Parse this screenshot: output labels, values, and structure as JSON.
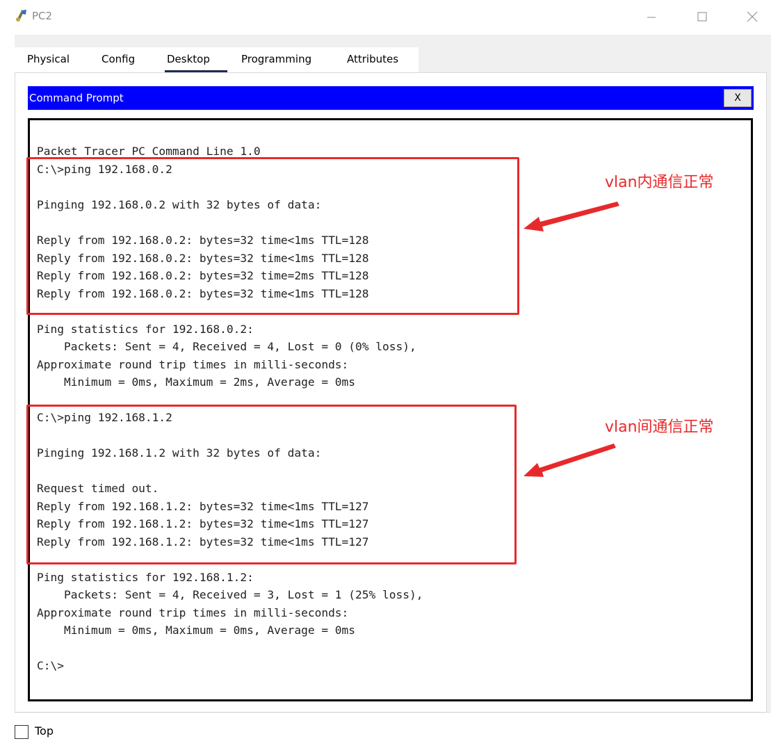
{
  "window": {
    "title": "PC2",
    "icon": "packet-tracer-pc-icon",
    "minimize_icon": "minimize-icon",
    "maximize_icon": "maximize-icon",
    "close_icon": "close-icon"
  },
  "tabs": [
    {
      "label": "Physical"
    },
    {
      "label": "Config"
    },
    {
      "label": "Desktop",
      "active": true
    },
    {
      "label": "Programming"
    },
    {
      "label": "Attributes"
    }
  ],
  "command_prompt": {
    "title": "Command Prompt",
    "close_label": "X",
    "lines": [
      "Packet Tracer PC Command Line 1.0",
      "C:\\>ping 192.168.0.2",
      "",
      "Pinging 192.168.0.2 with 32 bytes of data:",
      "",
      "Reply from 192.168.0.2: bytes=32 time<1ms TTL=128",
      "Reply from 192.168.0.2: bytes=32 time<1ms TTL=128",
      "Reply from 192.168.0.2: bytes=32 time=2ms TTL=128",
      "Reply from 192.168.0.2: bytes=32 time<1ms TTL=128",
      "",
      "Ping statistics for 192.168.0.2:",
      "    Packets: Sent = 4, Received = 4, Lost = 0 (0% loss),",
      "Approximate round trip times in milli-seconds:",
      "    Minimum = 0ms, Maximum = 2ms, Average = 0ms",
      "",
      "C:\\>ping 192.168.1.2",
      "",
      "Pinging 192.168.1.2 with 32 bytes of data:",
      "",
      "Request timed out.",
      "Reply from 192.168.1.2: bytes=32 time<1ms TTL=127",
      "Reply from 192.168.1.2: bytes=32 time<1ms TTL=127",
      "Reply from 192.168.1.2: bytes=32 time<1ms TTL=127",
      "",
      "Ping statistics for 192.168.1.2:",
      "    Packets: Sent = 4, Received = 3, Lost = 1 (25% loss),",
      "Approximate round trip times in milli-seconds:",
      "    Minimum = 0ms, Maximum = 0ms, Average = 0ms",
      "",
      "C:\\>"
    ]
  },
  "annotations": {
    "note1": "vlan内通信正常",
    "note2": "vlan间通信正常",
    "color": "#e8292b"
  },
  "footer": {
    "top_label": "Top",
    "top_checked": false
  }
}
